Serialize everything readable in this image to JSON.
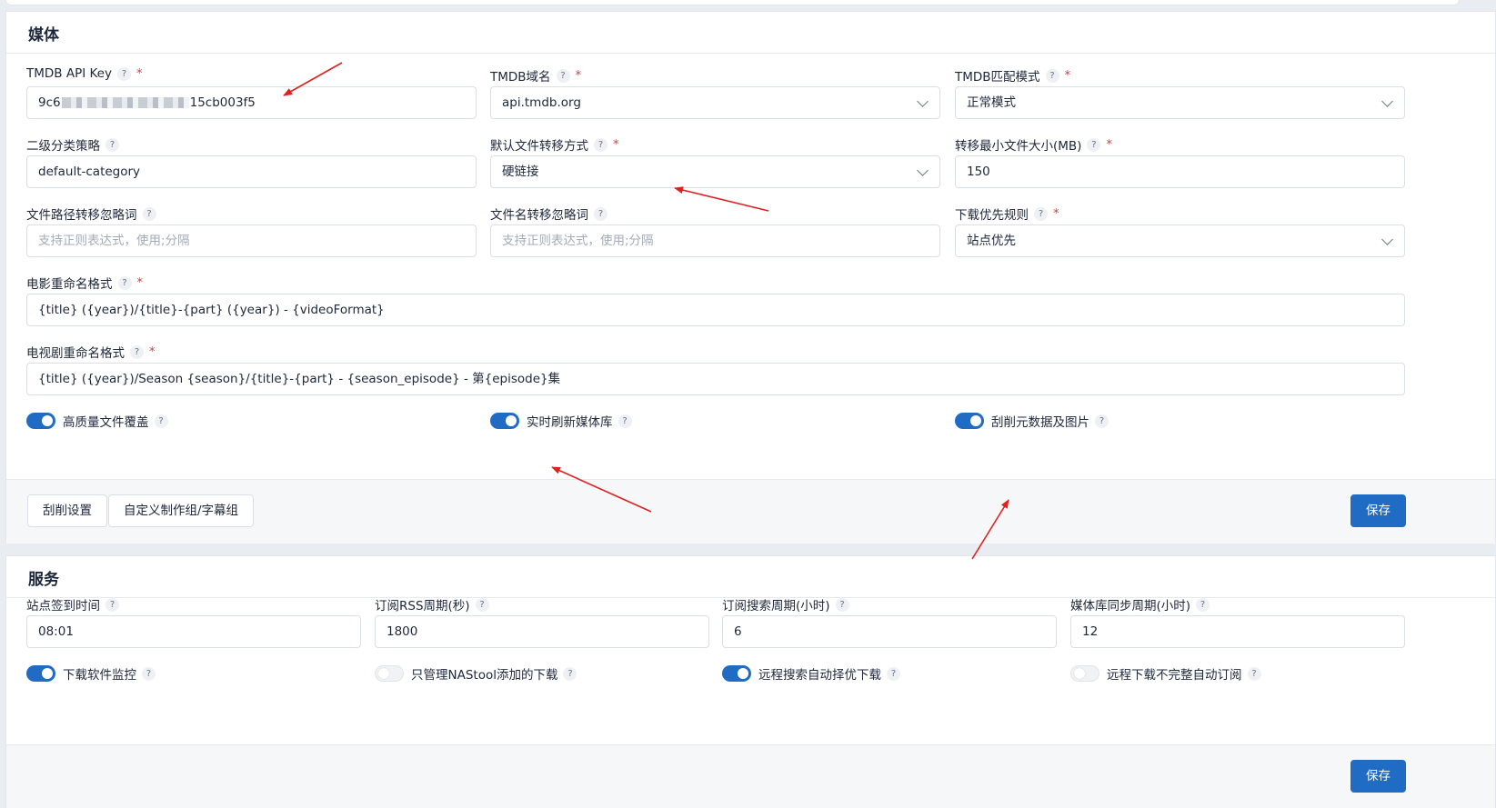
{
  "media": {
    "title": "媒体",
    "tmdb_api_key": {
      "label": "TMDB API Key",
      "value_prefix": "9c6",
      "value_suffix": "15cb003f5"
    },
    "tmdb_domain": {
      "label": "TMDB域名",
      "value": "api.tmdb.org"
    },
    "tmdb_match_mode": {
      "label": "TMDB匹配模式",
      "value": "正常模式"
    },
    "secondary_category": {
      "label": "二级分类策略",
      "value": "default-category"
    },
    "transfer_mode": {
      "label": "默认文件转移方式",
      "value": "硬链接"
    },
    "min_file_size": {
      "label": "转移最小文件大小(MB)",
      "value": "150"
    },
    "path_ignore": {
      "label": "文件路径转移忽略词",
      "placeholder": "支持正则表达式，使用;分隔"
    },
    "filename_ignore": {
      "label": "文件名转移忽略词",
      "placeholder": "支持正则表达式，使用;分隔"
    },
    "download_priority": {
      "label": "下载优先规则",
      "value": "站点优先"
    },
    "movie_rename": {
      "label": "电影重命名格式",
      "value": "{title} ({year})/{title}-{part} ({year}) - {videoFormat}"
    },
    "tv_rename": {
      "label": "电视剧重命名格式",
      "value": "{title} ({year})/Season {season}/{title}-{part} - {season_episode} - 第{episode}集"
    },
    "toggles": {
      "hq_overwrite": "高质量文件覆盖",
      "realtime_refresh": "实时刷新媒体库",
      "scrape_metadata": "刮削元数据及图片"
    },
    "buttons": {
      "scrape_settings": "刮削设置",
      "custom_groups": "自定义制作组/字幕组",
      "save": "保存"
    }
  },
  "service": {
    "title": "服务",
    "checkin_time": {
      "label": "站点签到时间",
      "value": "08:01"
    },
    "rss_interval": {
      "label": "订阅RSS周期(秒)",
      "value": "1800"
    },
    "search_interval": {
      "label": "订阅搜索周期(小时)",
      "value": "6"
    },
    "library_sync": {
      "label": "媒体库同步周期(小时)",
      "value": "12"
    },
    "toggles": {
      "downloader_monitor": "下载软件监控",
      "only_nastool": "只管理NAStool添加的下载",
      "remote_auto_select": "远程搜索自动择优下载",
      "remote_incomplete_subscribe": "远程下载不完整自动订阅"
    },
    "buttons": {
      "save": "保存"
    }
  },
  "common": {
    "help": "?",
    "required": "*"
  },
  "colors": {
    "primary": "#206bc4",
    "annotation_arrow": "#e02020",
    "required": "#d63939"
  }
}
